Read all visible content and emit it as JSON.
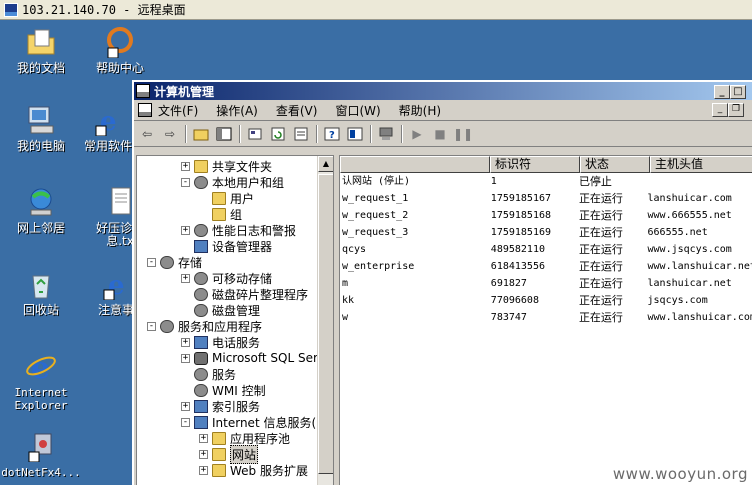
{
  "remote_bar": {
    "title": "103.21.140.70 - 远程桌面"
  },
  "desktop": {
    "icons": [
      {
        "label": "我的文档",
        "icon": "documents-folder-icon"
      },
      {
        "label": "帮助中心",
        "icon": "help-center-icon"
      },
      {
        "label": "我的电脑",
        "icon": "my-computer-icon"
      },
      {
        "label": "常用软件",
        "icon": "ie-shortcut-icon"
      },
      {
        "label": "网上邻居",
        "icon": "network-places-icon"
      },
      {
        "label": "好压诊断",
        "label2": "息.tx",
        "icon": "text-file-icon"
      },
      {
        "label": "回收站",
        "icon": "recycle-bin-icon"
      },
      {
        "label": "注意事",
        "icon": "ie-shortcut-icon"
      },
      {
        "label": "Internet",
        "label2": "Explorer",
        "icon": "internet-explorer-icon"
      },
      {
        "label": "dotNetFx4...",
        "icon": "installer-icon"
      }
    ]
  },
  "window": {
    "title": "计算机管理",
    "menu": [
      "文件(F)",
      "操作(A)",
      "查看(V)",
      "窗口(W)",
      "帮助(H)"
    ],
    "tree": [
      {
        "label": "共享文件夹",
        "level": 1,
        "toggle": "+",
        "icon": "folder"
      },
      {
        "label": "本地用户和组",
        "level": 1,
        "toggle": "-",
        "icon": "gear"
      },
      {
        "label": "用户",
        "level": 2,
        "toggle": "",
        "icon": "folder"
      },
      {
        "label": "组",
        "level": 2,
        "toggle": "",
        "icon": "folder"
      },
      {
        "label": "性能日志和警报",
        "level": 1,
        "toggle": "+",
        "icon": "gear"
      },
      {
        "label": "设备管理器",
        "level": 1,
        "toggle": "",
        "icon": "pc"
      },
      {
        "label": "存储",
        "level": 0,
        "toggle": "-",
        "icon": "gear"
      },
      {
        "label": "可移动存储",
        "level": 1,
        "toggle": "+",
        "icon": "gear"
      },
      {
        "label": "磁盘碎片整理程序",
        "level": 1,
        "toggle": "",
        "icon": "gear"
      },
      {
        "label": "磁盘管理",
        "level": 1,
        "toggle": "",
        "icon": "gear"
      },
      {
        "label": "服务和应用程序",
        "level": 0,
        "toggle": "-",
        "icon": "gear"
      },
      {
        "label": "电话服务",
        "level": 1,
        "toggle": "+",
        "icon": "pc"
      },
      {
        "label": "Microsoft SQL Server",
        "level": 1,
        "toggle": "+",
        "icon": "db"
      },
      {
        "label": "服务",
        "level": 1,
        "toggle": "",
        "icon": "gear"
      },
      {
        "label": "WMI 控制",
        "level": 1,
        "toggle": "",
        "icon": "gear"
      },
      {
        "label": "索引服务",
        "level": 1,
        "toggle": "+",
        "icon": "pc"
      },
      {
        "label": "Internet 信息服务(II",
        "level": 1,
        "toggle": "-",
        "icon": "pc"
      },
      {
        "label": "应用程序池",
        "level": 2,
        "toggle": "+",
        "icon": "folder"
      },
      {
        "label": "网站",
        "level": 2,
        "toggle": "+",
        "icon": "folder",
        "selected": true
      },
      {
        "label": "Web 服务扩展",
        "level": 2,
        "toggle": "+",
        "icon": "folder"
      }
    ],
    "columns": [
      "",
      "标识符",
      "状态",
      "主机头值"
    ],
    "rows": [
      [
        "认网站 (停止)",
        "1",
        "已停止",
        ""
      ],
      [
        "w_request_1",
        "1759185167",
        "正在运行",
        "lanshuicar.com"
      ],
      [
        "w_request_2",
        "1759185168",
        "正在运行",
        "www.666555.net"
      ],
      [
        "w_request_3",
        "1759185169",
        "正在运行",
        "666555.net"
      ],
      [
        "qcys",
        "489582110",
        "正在运行",
        "www.jsqcys.com"
      ],
      [
        "w_enterprise",
        "618413556",
        "正在运行",
        "www.lanshuicar.net"
      ],
      [
        "m",
        "691827",
        "正在运行",
        "lanshuicar.net"
      ],
      [
        "kk",
        "77096608",
        "正在运行",
        "jsqcys.com"
      ],
      [
        "w",
        "783747",
        "正在运行",
        "www.lanshuicar.com"
      ]
    ]
  },
  "watermark": "www.wooyun.org"
}
